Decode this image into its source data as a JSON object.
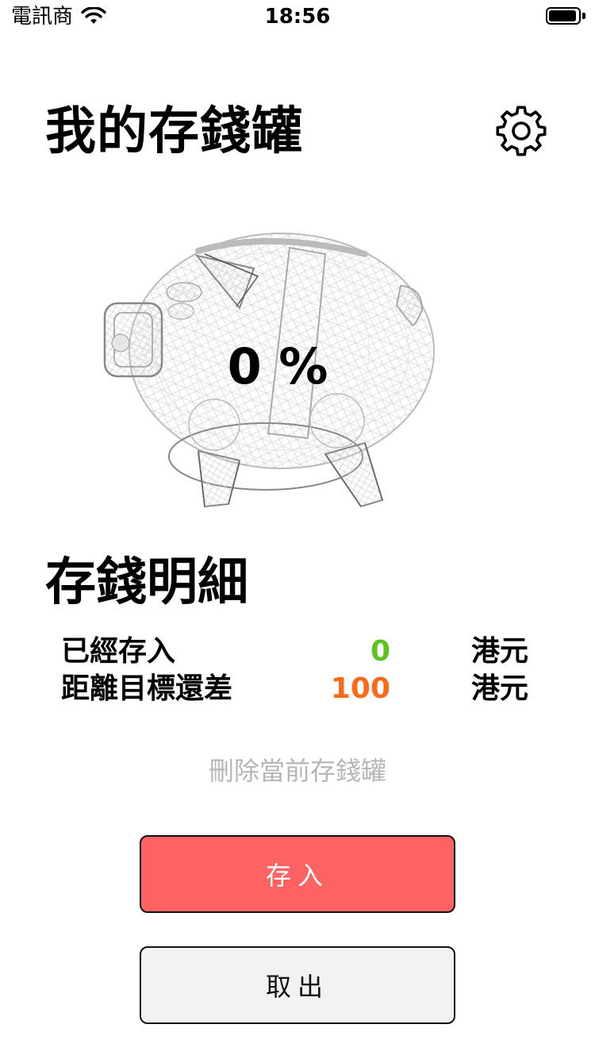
{
  "status_bar": {
    "carrier": "電訊商",
    "time": "18:56",
    "battery_level": 0.95
  },
  "header": {
    "title": "我的存錢罐",
    "settings_icon": "gear-icon"
  },
  "piggy": {
    "progress_text": "0 %",
    "progress_fraction": 0.0
  },
  "details": {
    "title": "存錢明細",
    "rows": [
      {
        "label": "已經存入",
        "value": "0",
        "unit": "港元",
        "color": "#5ac41f"
      },
      {
        "label": "距離目標還差",
        "value": "100",
        "unit": "港元",
        "color": "#ff6a1a"
      }
    ]
  },
  "actions": {
    "delete_label": "刪除當前存錢罐",
    "deposit_label": "存入",
    "withdraw_label": "取出",
    "deposit_color": "#ff6262"
  }
}
